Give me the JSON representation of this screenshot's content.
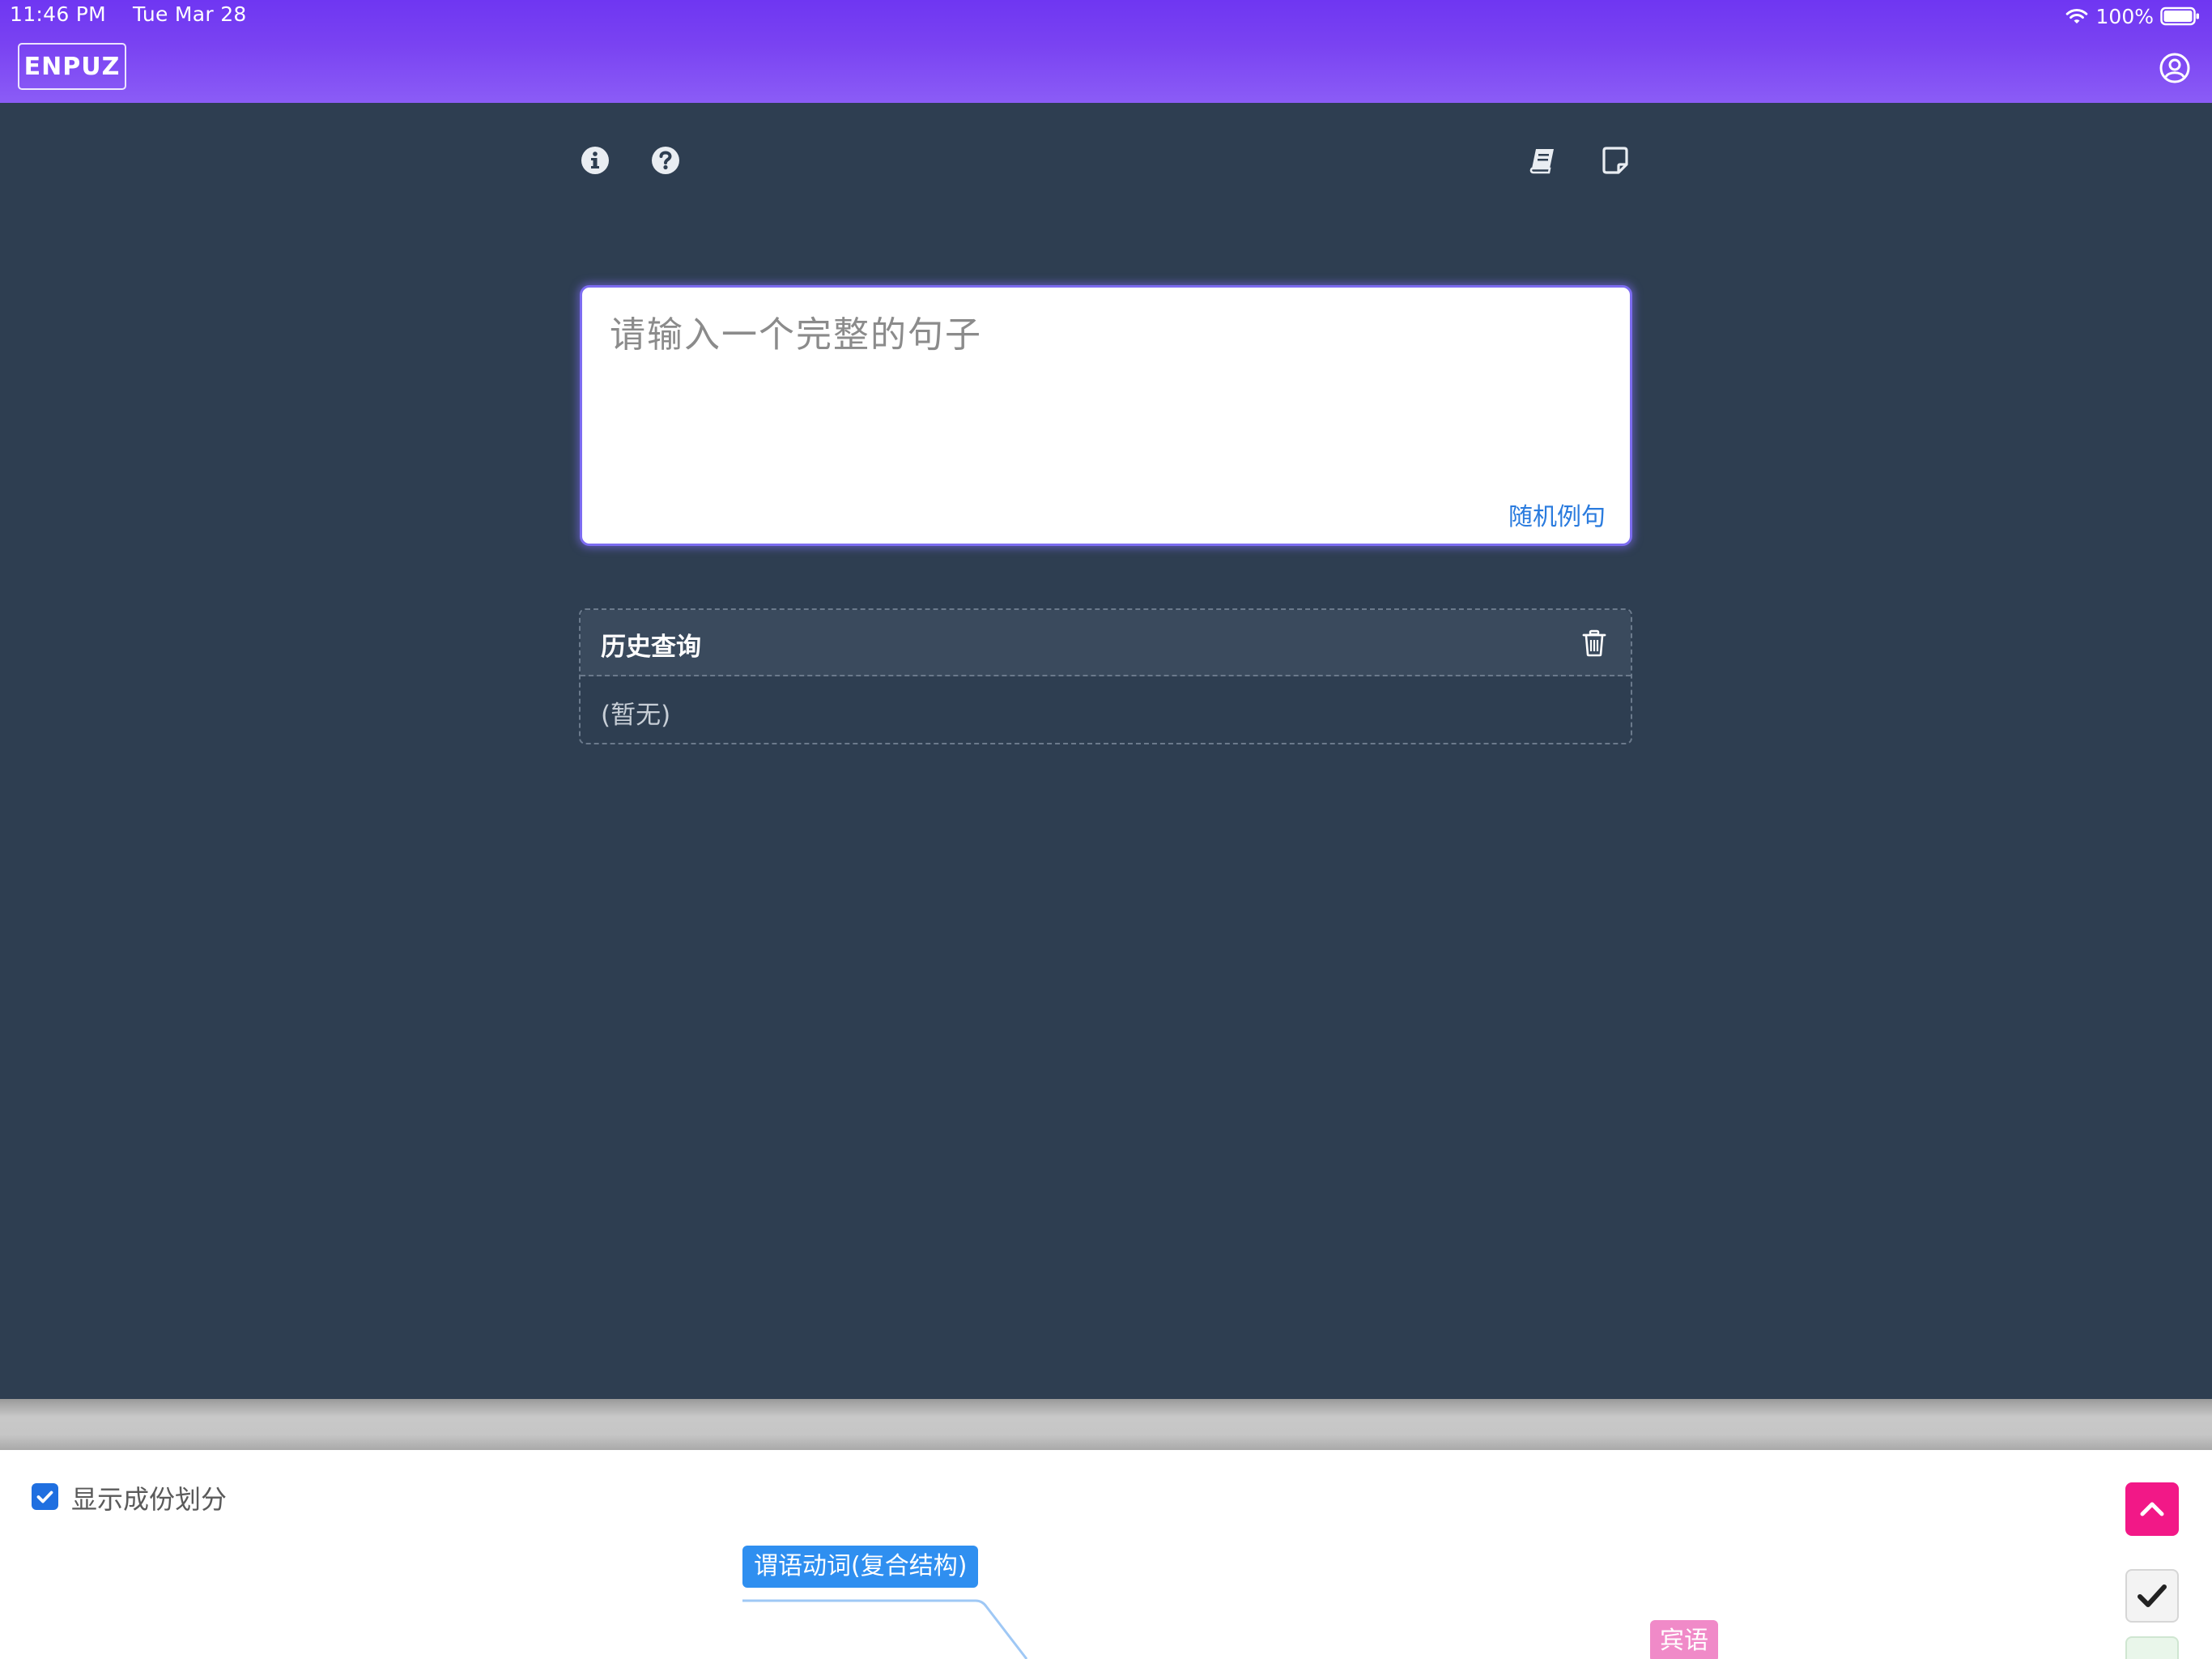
{
  "status_bar": {
    "time": "11:46 PM",
    "date": "Tue Mar 28",
    "battery": "100%"
  },
  "header": {
    "brand": "ENPUZ",
    "color_start": "#6f36f2",
    "color_end": "#8b5cf6"
  },
  "toolbar": {
    "icons": [
      "info-icon",
      "help-icon",
      "book-icon",
      "note-icon"
    ]
  },
  "input": {
    "placeholder": "请输入一个完整的句子",
    "random_link": "随机例句"
  },
  "history": {
    "title": "历史查询",
    "empty_text": "(暂无)"
  },
  "bottom": {
    "checkbox_label": "显示成份划分",
    "checkbox_checked": true,
    "nodes": {
      "verb": "谓语动词(复合结构)",
      "object": "宾语"
    }
  },
  "colors": {
    "page_bg": "#2e3e51",
    "accent_blue": "#2f8ff0",
    "object_pink": "#f08ac8",
    "scroll_button": "#f21887",
    "link_blue": "#2a7bde"
  }
}
